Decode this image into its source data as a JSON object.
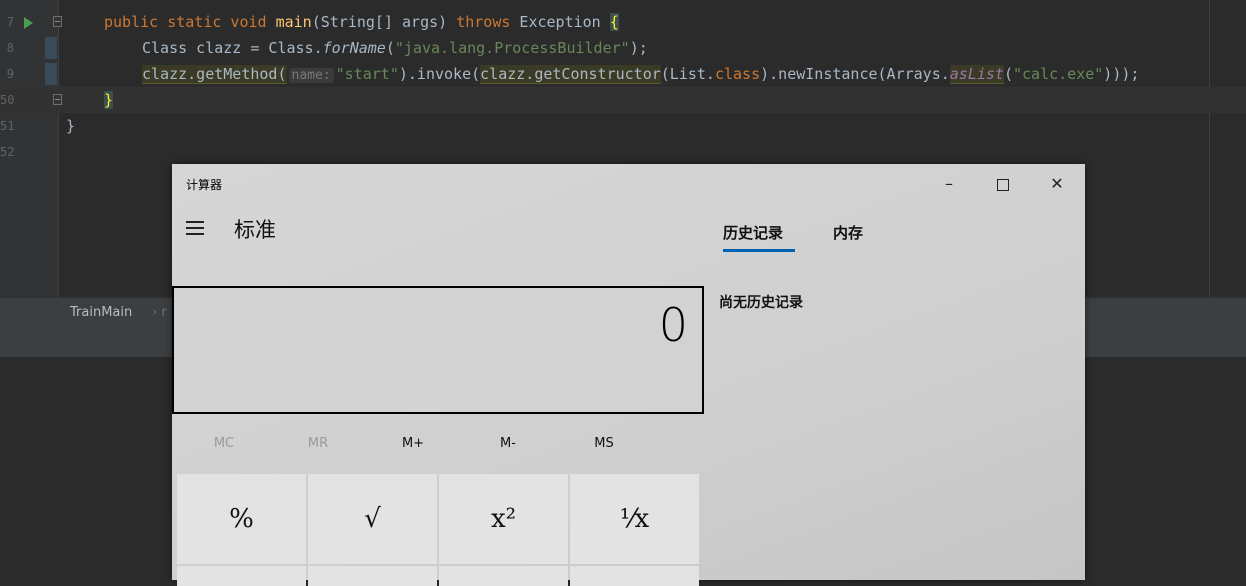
{
  "editor": {
    "line_numbers": [
      "7",
      "8",
      "9",
      "50",
      "51",
      "52"
    ],
    "line1": {
      "kw1": "public static void ",
      "fn": "main",
      "args": "(String[] args) ",
      "kw2": "throws",
      "rest": " Exception ",
      "brace": "{"
    },
    "line2": {
      "pre": "Class clazz = Class.",
      "method": "forName",
      "open": "(",
      "str": "\"java.lang.ProcessBuilder\"",
      "close": ");"
    },
    "line3": {
      "p1": "clazz.getMethod(",
      "hint": "name:",
      "s1": "\"start\"",
      "p2": ").invoke(",
      "p3": "clazz.getConstructor",
      "p4": "(List.",
      "kw": "class",
      "p5": ").newInstance(Arrays.",
      "p6": "asList",
      "p7": "(",
      "s2": "\"calc.exe\"",
      "p8": ")));"
    },
    "line4": {
      "brace": "}"
    },
    "line5": {
      "brace": "}"
    }
  },
  "breadcrumb": {
    "item": "TrainMain",
    "sep": "›",
    "trail": "r"
  },
  "calculator": {
    "title": "计算器",
    "window_buttons": {
      "minimize": "–",
      "close": "✕"
    },
    "mode": "标准",
    "display_value": "0",
    "memory": [
      "MC",
      "MR",
      "M+",
      "M-",
      "MS"
    ],
    "keys": [
      "%",
      "√",
      "x²",
      "⅟x"
    ],
    "tabs": {
      "history": "历史记录",
      "memory": "内存"
    },
    "empty_history": "尚无历史记录"
  },
  "colors": {
    "accent": "#0063b1",
    "ide_bg": "#2b2b2b",
    "keyword": "#cc7832",
    "string": "#6a8759"
  }
}
